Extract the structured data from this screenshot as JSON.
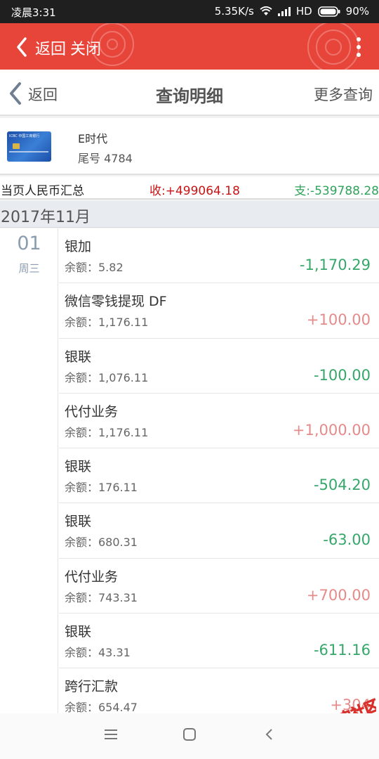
{
  "status_bar": {
    "time": "凌晨3:31",
    "speed": "5.35K/s",
    "network": "HD",
    "battery": "90%"
  },
  "web_header": {
    "back_label": "返回",
    "close_label": "关闭"
  },
  "nav": {
    "back_label": "返回",
    "title": "查询明细",
    "more_label": "更多查询"
  },
  "card": {
    "bank_logo_text": "ICBC 中国工商银行",
    "name": "E时代",
    "tail": "尾号 4784"
  },
  "summary": {
    "label": "当页人民币汇总",
    "income": "收:+499064.18",
    "expense": "支:-539788.28"
  },
  "month": "2017年11月",
  "date": {
    "day": "01",
    "weekday": "周三"
  },
  "transactions": [
    {
      "name": "银加",
      "balance": "余额：5.82",
      "amount": "-1,170.29",
      "direction": "out"
    },
    {
      "name": "微信零钱提现 DF",
      "balance": "余额：1,176.11",
      "amount": "+100.00",
      "direction": "in"
    },
    {
      "name": "银联",
      "balance": "余额：1,076.11",
      "amount": "-100.00",
      "direction": "out"
    },
    {
      "name": "代付业务",
      "balance": "余额：1,176.11",
      "amount": "+1,000.00",
      "direction": "in"
    },
    {
      "name": "银联",
      "balance": "余额：176.11",
      "amount": "-504.20",
      "direction": "out"
    },
    {
      "name": "银联",
      "balance": "余额：680.31",
      "amount": "-63.00",
      "direction": "out"
    },
    {
      "name": "代付业务",
      "balance": "余额：743.31",
      "amount": "+700.00",
      "direction": "in"
    },
    {
      "name": "银联",
      "balance": "余额：43.31",
      "amount": "-611.16",
      "direction": "out"
    },
    {
      "name": "跨行汇款",
      "balance": "余额：654.47",
      "amount": "+304",
      "direction": "in"
    }
  ],
  "watermark": "卡农社区",
  "colors": {
    "header_red": "#e8453a",
    "income_red": "#c81414",
    "expense_green": "#2ea35a",
    "amount_in": "#e58a8a",
    "amount_out": "#36a76a"
  }
}
